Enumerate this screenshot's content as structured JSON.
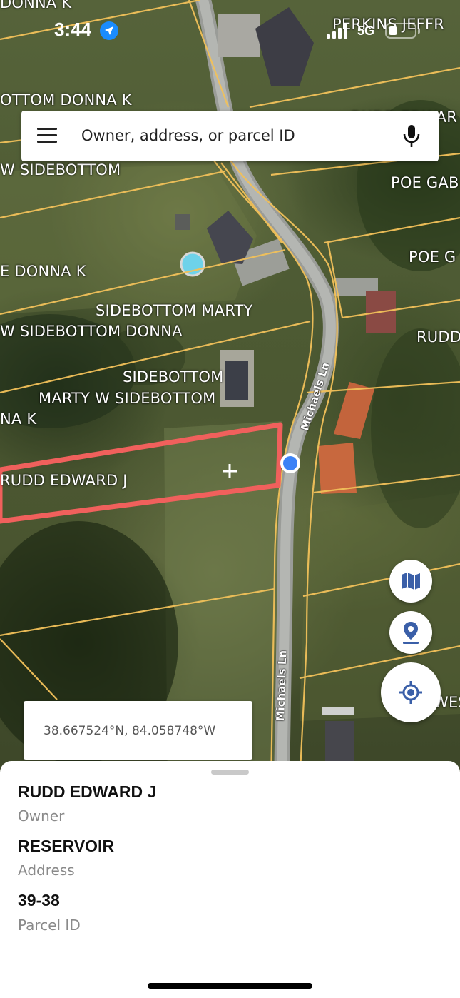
{
  "status_bar": {
    "time": "3:44",
    "network": "5G",
    "icons": [
      "location-arrow-icon",
      "signal-bars-icon",
      "battery-icon"
    ]
  },
  "search": {
    "placeholder": "Owner, address, or parcel ID",
    "icons": [
      "menu-icon",
      "microphone-icon"
    ]
  },
  "map": {
    "owner_labels": [
      "DONNA K",
      "PERKINS JEFFR",
      "OTTOM DONNA K",
      "RUDD EDWAR",
      "W SIDEBOTTOM",
      "POE GAB",
      "POE G",
      "E DONNA K",
      "SIDEBOTTOM MARTY",
      "W SIDEBOTTOM DONNA",
      "RUDD",
      "SIDEBOTTOM",
      "MARTY W SIDEBOTTOM",
      "NA K",
      "RUDD EDWARD J",
      "WES"
    ],
    "road_labels": [
      "Michaels Ln",
      "Michaels Ln"
    ],
    "coordinates": "38.667524°N, 84.058748°W",
    "colors": {
      "parcel_lines": "#f2c15a",
      "selected_parcel": "#f0605c",
      "location_dot": "#3b82f6"
    }
  },
  "map_controls": {
    "icons": [
      "map-layers-icon",
      "drop-pin-icon",
      "my-location-icon"
    ]
  },
  "parcel": {
    "owner": "RUDD EDWARD J",
    "owner_label": "Owner",
    "address": "RESERVOIR",
    "address_label": "Address",
    "parcel_id": "39-38",
    "parcel_id_label": "Parcel ID"
  }
}
